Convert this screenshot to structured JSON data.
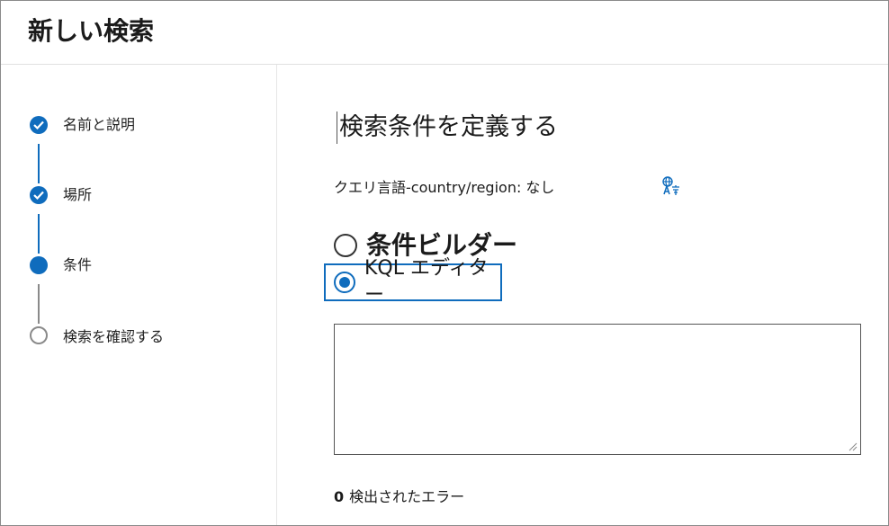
{
  "header": {
    "title": "新しい検索"
  },
  "wizard": {
    "steps": [
      {
        "label": "名前と説明",
        "state": "done"
      },
      {
        "label": "場所",
        "state": "done"
      },
      {
        "label": "条件",
        "state": "current"
      },
      {
        "label": "検索を確認する",
        "state": "pending"
      }
    ]
  },
  "main": {
    "title": "検索条件を定義する",
    "query_language_label": "クエリ言語-country/region: なし",
    "translate_icon": "translate-icon",
    "options": [
      {
        "label": "条件ビルダー",
        "selected": false
      },
      {
        "label": "KQL エディター",
        "selected": true
      }
    ],
    "kql_value": "",
    "error_count": "0",
    "error_label": "検出されたエラー"
  },
  "colors": {
    "accent": "#0f6cbd",
    "pending": "#8a8a8a",
    "text": "#1b1b1b"
  }
}
